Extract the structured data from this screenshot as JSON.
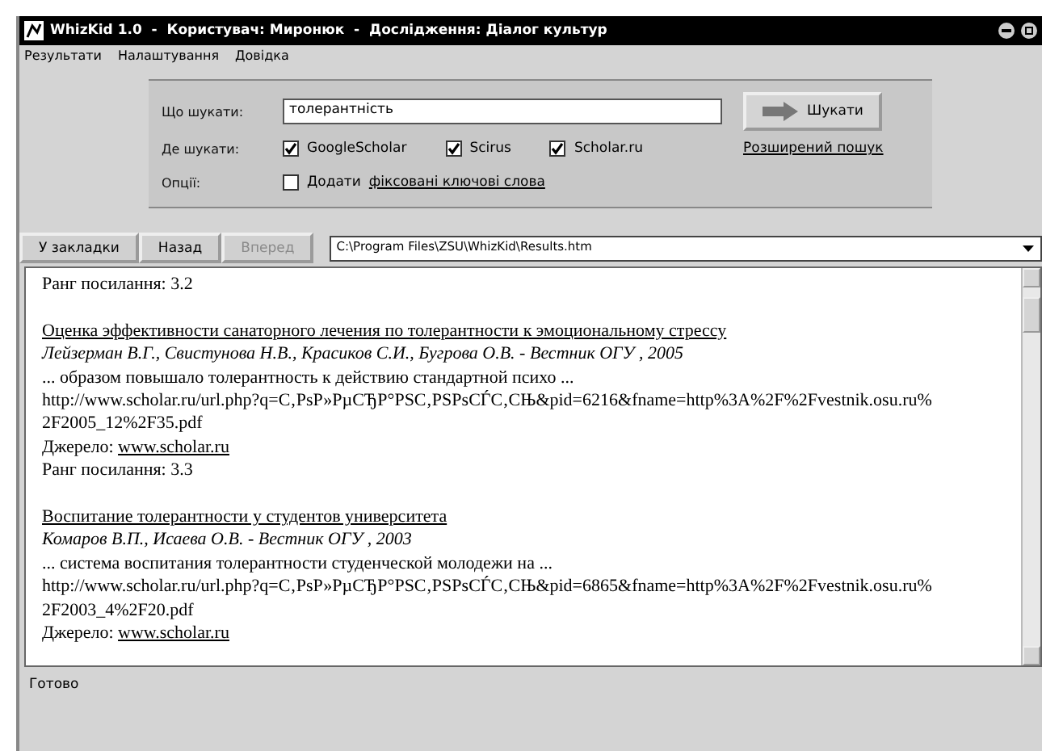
{
  "window": {
    "title": "WhizKid 1.0  -  Користувач: Миронюк  -  Дослідження: Діалог культур"
  },
  "menu": [
    "Результати",
    "Налаштування",
    "Довідка"
  ],
  "search": {
    "query_label": "Що шукати:",
    "query": "толерантність",
    "where_label": "Де шукати:",
    "sources": [
      {
        "label": "GoogleScholar",
        "checked": true
      },
      {
        "label": "Scirus",
        "checked": true
      },
      {
        "label": "Scholar.ru",
        "checked": true
      }
    ],
    "options_label": "Опції:",
    "option": {
      "label": "Додати",
      "link": "фіксовані  ключові слова",
      "checked": false
    },
    "search_button": "Шукати",
    "advanced_link": "Розширений пошук"
  },
  "toolbar": {
    "buttons": [
      {
        "label": "У закладки",
        "disabled": false
      },
      {
        "label": "Назад",
        "disabled": false
      },
      {
        "label": "Вперед",
        "disabled": true
      }
    ],
    "address": "C:\\Program Files\\ZSU\\WhizKid\\Results.htm"
  },
  "results_top_rank": "Ранг посилання: 3.2",
  "results": [
    {
      "title": "Оценка эффективности санаторного лечения по толерантности к эмоциональному стрессу",
      "authors": "Лейзерман В.Г., Свистунова Н.В., Красиков С.И., Бугрова О.В. - Вестник ОГУ , 2005",
      "snippet": "... образом повышало толерантность к действию стандартной психо ...",
      "url_lines": [
        "http://www.scholar.ru/url.php?q=С‚РѕР»РµСЂР°РЅС‚РЅРѕСЃС‚СЊ&pid=6216&fname=http%3A%2F%2Fvestnik.osu.ru%",
        "2F2005_12%2F35.pdf"
      ],
      "source_label": "Джерело:",
      "source": "www.scholar.ru",
      "rank": "Ранг посилання: 3.3"
    },
    {
      "title": "Воспитание толерантности у студентов университета",
      "authors": "Комаров В.П., Исаева О.В. - Вестник ОГУ , 2003",
      "snippet": "... система воспитания толерантности студенческой молодежи на ...",
      "url_lines": [
        "http://www.scholar.ru/url.php?q=С‚РѕР»РµСЂР°РЅС‚РЅРѕСЃС‚СЊ&pid=6865&fname=http%3A%2F%2Fvestnik.osu.ru%",
        "2F2003_4%2F20.pdf"
      ],
      "source_label": "Джерело:",
      "source": "www.scholar.ru"
    }
  ],
  "status_bar": "Готово"
}
